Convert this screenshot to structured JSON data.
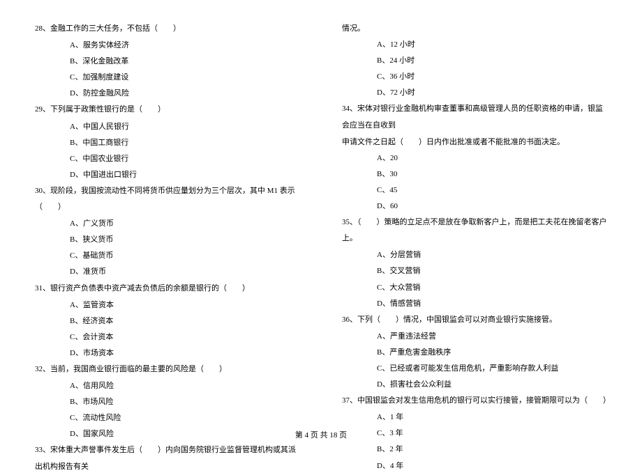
{
  "left": {
    "q28": {
      "stem": "28、金融工作的三大任务，不包括（　　）",
      "a": "A、服务实体经济",
      "b": "B、深化金融改革",
      "c": "C、加强制度建设",
      "d": "D、防控金融风险"
    },
    "q29": {
      "stem": "29、下列属于政策性银行的是（　　）",
      "a": "A、中国人民银行",
      "b": "B、中国工商银行",
      "c": "C、中国农业银行",
      "d": "D、中国进出口银行"
    },
    "q30": {
      "stem": "30、现阶段，我国按流动性不同将货币供应量划分为三个层次，其中 M1 表示（　　）",
      "a": "A、广义货币",
      "b": "B、狭义货币",
      "c": "C、基础货币",
      "d": "D、准货币"
    },
    "q31": {
      "stem": "31、银行资产负债表中资产减去负债后的余额是银行的（　　）",
      "a": "A、监管资本",
      "b": "B、经济资本",
      "c": "C、会计资本",
      "d": "D、市场资本"
    },
    "q32": {
      "stem": "32、当前，我国商业银行面临的最主要的风险是（　　）",
      "a": "A、信用风险",
      "b": "B、市场风险",
      "c": "C、流动性风险",
      "d": "D、国家风险"
    },
    "q33": {
      "stem": "33、宋体重大声誉事件发生后（　　）内向国务院银行业监督管理机构或其派出机构报告有关"
    }
  },
  "right": {
    "q33cont": {
      "stem": "情况。",
      "a": "A、12 小时",
      "b": "B、24 小时",
      "c": "C、36 小时",
      "d": "D、72 小时"
    },
    "q34": {
      "stem1": "34、宋体对银行业金融机构审查董事和高级管理人员的任职资格的申请，银监会应当在自收到",
      "stem2": "申请文件之日起（　　）日内作出批准或者不能批准的书面决定。",
      "a": "A、20",
      "b": "B、30",
      "c": "C、45",
      "d": "D、60"
    },
    "q35": {
      "stem": "35、（　　）策略的立足点不是放在争取新客户上，而是把工夫花在挽留老客户上。",
      "a": "A、分层营销",
      "b": "B、交叉营销",
      "c": "C、大众营销",
      "d": "D、情感营销"
    },
    "q36": {
      "stem": "36、下列（　　）情况，中国银监会可以对商业银行实施接管。",
      "a": "A、严重违法经营",
      "b": "B、严重危害金融秩序",
      "c": "C、已经或者可能发生信用危机，严重影响存款人利益",
      "d": "D、损害社会公众利益"
    },
    "q37": {
      "stem": "37、中国银监会对发生信用危机的银行可以实行接管，接管期限可以为（　　）",
      "a": "A、1 年",
      "c": "C、3 年",
      "b": "B、2 年",
      "d": "D、4 年"
    }
  },
  "footer": "第 4 页 共 18 页"
}
